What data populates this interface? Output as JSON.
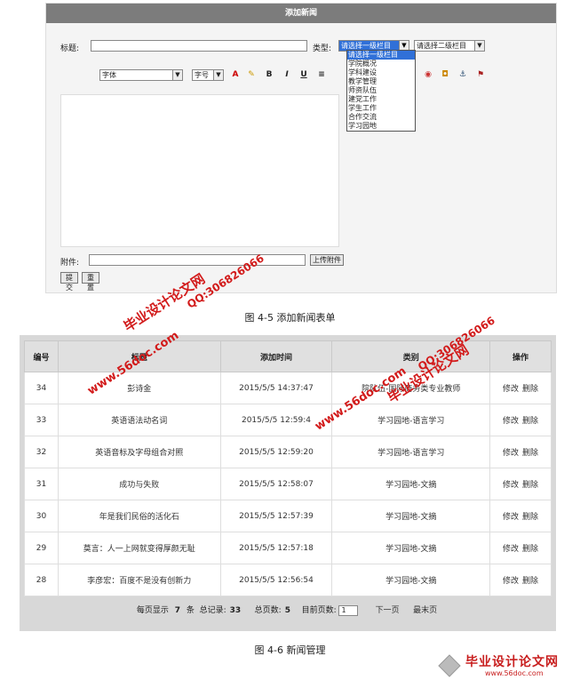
{
  "form": {
    "header_title": "添加新闻",
    "title_label": "标题:",
    "type_label": "类型:",
    "category1_select": "请选择一级栏目",
    "category2_select": "请选择二级栏目",
    "category1_options": [
      "请选择一级栏目",
      "学院概况",
      "学科建设",
      "教学管理",
      "师资队伍",
      "建党工作",
      "学生工作",
      "合作交流",
      "学习园地"
    ],
    "font_select": "字体",
    "size_select": "字号",
    "attachment_label": "附件:",
    "upload_button": "上传附件",
    "submit_button": "提交",
    "reset_button": "重置",
    "toolbar": {
      "bold": "B",
      "italic": "I",
      "underline": "U"
    }
  },
  "captions": {
    "fig5": "图 4-5 添加新闻表单",
    "fig6": "图 4-6 新闻管理"
  },
  "table": {
    "headers": [
      "编号",
      "标题",
      "添加时间",
      "类别",
      "操作"
    ],
    "rows": [
      {
        "id": "34",
        "title": "彭诗金",
        "time": "2015/5/5 14:37:47",
        "category": "院队伍-国际商务类专业教师",
        "edit": "修改",
        "del": "删除"
      },
      {
        "id": "33",
        "title": "英语语法动名词",
        "time": "2015/5/5 12:59:4",
        "category": "学习园地-语言学习",
        "edit": "修改",
        "del": "删除"
      },
      {
        "id": "32",
        "title": "英语音标及字母组合对照",
        "time": "2015/5/5 12:59:20",
        "category": "学习园地-语言学习",
        "edit": "修改",
        "del": "删除"
      },
      {
        "id": "31",
        "title": "成功与失败",
        "time": "2015/5/5 12:58:07",
        "category": "学习园地-文摘",
        "edit": "修改",
        "del": "删除"
      },
      {
        "id": "30",
        "title": "年是我们民俗的活化石",
        "time": "2015/5/5 12:57:39",
        "category": "学习园地-文摘",
        "edit": "修改",
        "del": "删除"
      },
      {
        "id": "29",
        "title": "莫言：人一上网就变得厚颜无耻",
        "time": "2015/5/5 12:57:18",
        "category": "学习园地-文摘",
        "edit": "修改",
        "del": "删除"
      },
      {
        "id": "28",
        "title": "李彦宏：百度不是没有创新力",
        "time": "2015/5/5 12:56:54",
        "category": "学习园地-文摘",
        "edit": "修改",
        "del": "删除"
      }
    ]
  },
  "pagination": {
    "per_page_label": "每页显示",
    "per_page": "7",
    "per_page_unit": "条",
    "total_records_label": "总记录:",
    "total_records": "33",
    "total_pages_label": "总页数:",
    "total_pages": "5",
    "current_page_label": "目前页数:",
    "current_page": "1",
    "next": "下一页",
    "last": "最末页"
  },
  "watermarks": {
    "a": "毕业设计论文网",
    "b": "www.56doc.com",
    "c": "QQ:306826066",
    "logo_text": "毕业设计论文网",
    "logo_url": "www.56doc.com"
  },
  "colors": {
    "accent_red": "#d21b1b",
    "select_blue": "#3070d8",
    "header_gray": "#7c7c7c"
  }
}
